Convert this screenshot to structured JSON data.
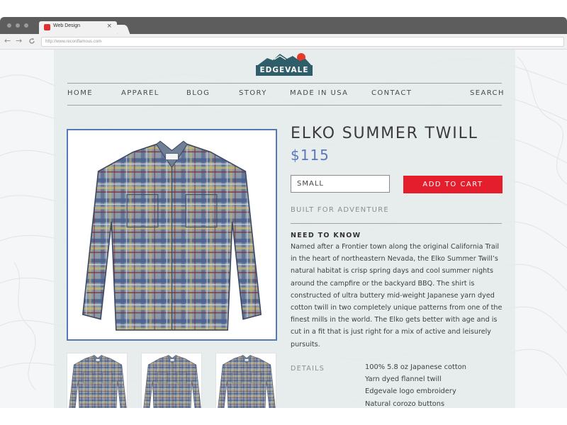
{
  "browser": {
    "tab_title": "Web Design",
    "tab_close": "×",
    "address": "http://www.recordfamous.com",
    "back_icon": "←",
    "forward_icon": "→"
  },
  "site": {
    "logo_text": "EDGEVALE",
    "nav": [
      "HOME",
      "APPAREL",
      "BLOG",
      "STORY",
      "MADE IN USA",
      "CONTACT",
      "SEARCH"
    ]
  },
  "product": {
    "title": "ELKO SUMMER TWILL",
    "price": "$115",
    "size_value": "SMALL",
    "add_to_cart": "ADD TO CART",
    "tagline": "BUILT FOR ADVENTURE",
    "need_to_know_heading": "NEED TO KNOW",
    "description": "Named after a Frontier town along the original California Trail in the heart of northeastern Nevada, the Elko Summer Twill’s natural habitat is crisp spring days and cool summer nights around the campfire or the backyard BBQ.  The shirt is constructed of ultra buttery mid-weight Japanese yarn dyed cotton twill in two completely unique patterns from one of the finest mills in the world.  The Elko gets better with age and is cut in a fit that is just right for a mix of active and leisurely pursuits.",
    "details_label": "DETAILS",
    "details": [
      "100% 5.8 oz Japanese cotton",
      "Yarn dyed flannel twill",
      "Edgevale logo embroidery",
      "Natural corozo buttons"
    ]
  },
  "colors": {
    "accent_blue": "#5a79bd",
    "cart_red": "#e41e2d",
    "logo_teal": "#2f5d6a"
  }
}
